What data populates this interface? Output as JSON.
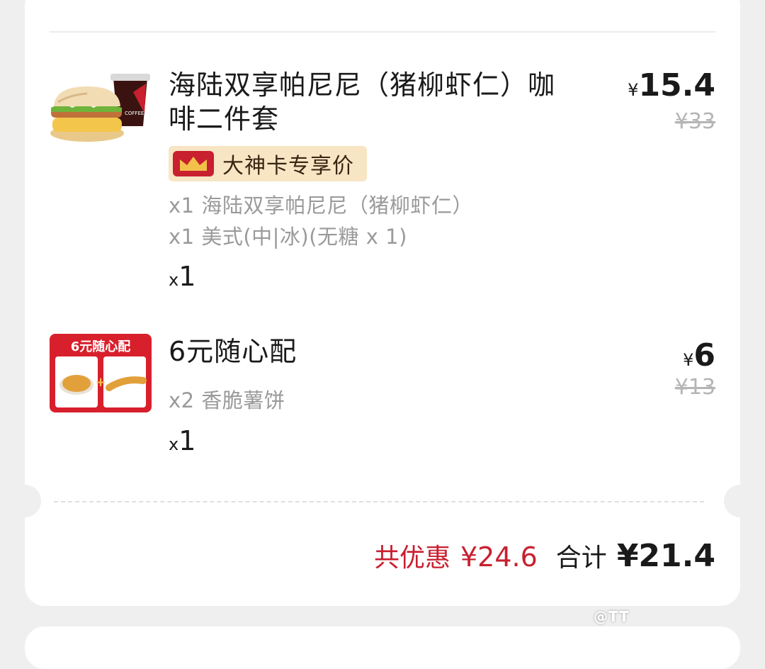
{
  "items": [
    {
      "title": "海陆双享帕尼尼（猪柳虾仁）咖啡二件套",
      "badge": "大神卡专享价",
      "details": [
        "x1 海陆双享帕尼尼（猪柳虾仁）",
        "x1 美式(中|冰)(无糖 x 1)"
      ],
      "qty_prefix": "x",
      "qty": "1",
      "currency": "¥",
      "price": "15.4",
      "original_price": "¥33"
    },
    {
      "title": "6元随心配",
      "image_label": "6元随心配",
      "details": [
        "x2 香脆薯饼"
      ],
      "qty_prefix": "x",
      "qty": "1",
      "currency": "¥",
      "price": "6",
      "original_price": "¥13"
    }
  ],
  "summary": {
    "discount_label": "共优惠",
    "discount_value": "¥24.6",
    "total_label": "合计",
    "total_value": "¥21.4"
  },
  "watermark": "@TT",
  "colors": {
    "accent_red": "#c8202f",
    "badge_bg": "#f7e5c4",
    "muted_text": "#9a9a9a"
  }
}
